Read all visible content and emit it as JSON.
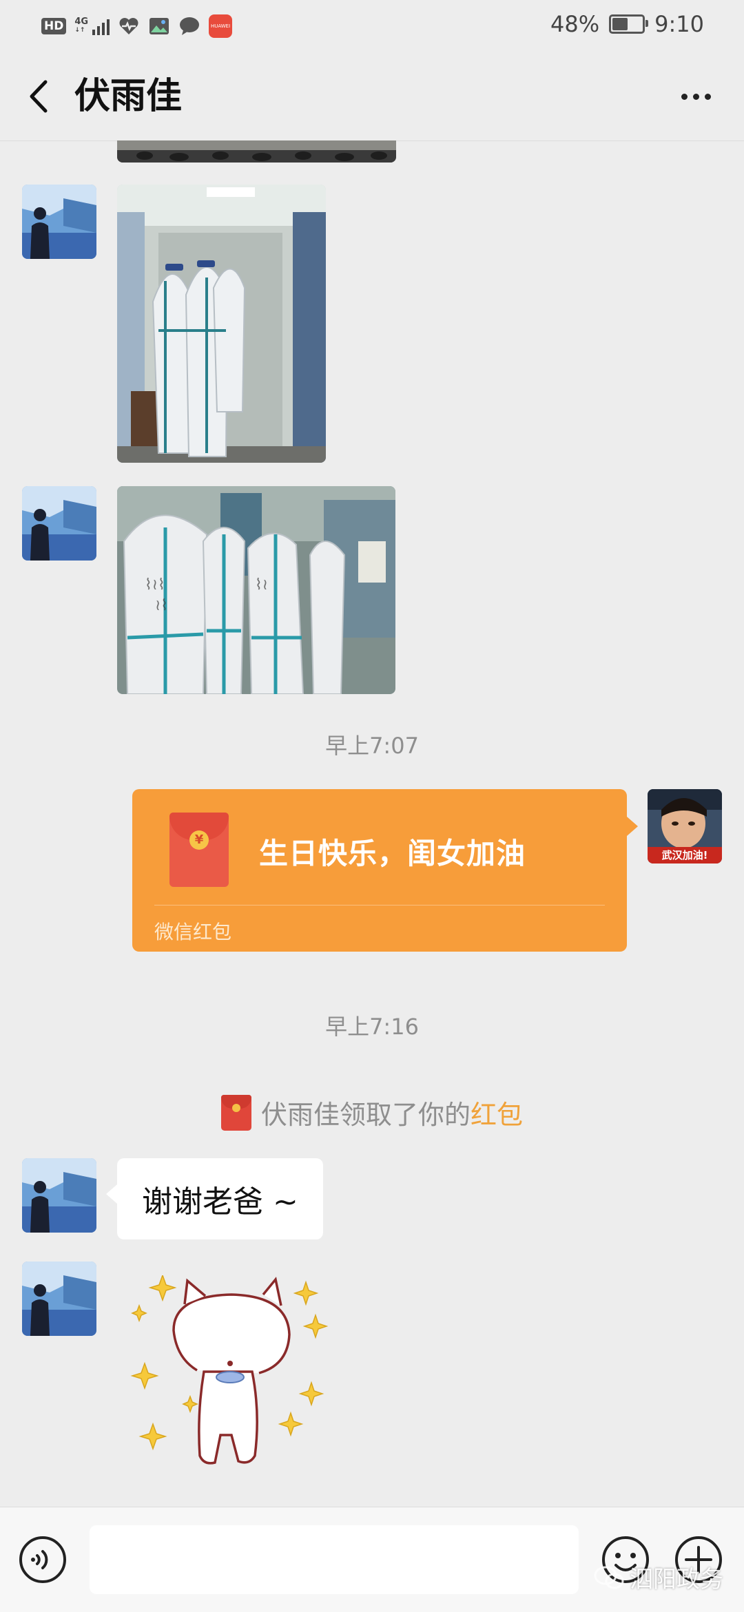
{
  "status_bar": {
    "hd": "HD",
    "network": "4G",
    "battery_percent": "48%",
    "battery_level": 0.48,
    "time": "9:10",
    "app_badge": "HUAWEI"
  },
  "header": {
    "title": "伏雨佳",
    "back_icon": "chevron-left-icon",
    "more_icon": "more-dots-icon"
  },
  "messages": {
    "time_1": "早上7:07",
    "red_packet": {
      "greeting": "生日快乐，闺女加油",
      "footer": "微信红包",
      "coin": "¥"
    },
    "sender_avatar_caption": "武汉加油!",
    "time_2": "早上7:16",
    "notice": {
      "text": "伏雨佳领取了你的",
      "link": "红包"
    },
    "reply": "谢谢老爸 ~"
  },
  "input_bar": {
    "placeholder": "",
    "voice_icon": "voice-icon",
    "emoji_icon": "emoji-icon",
    "plus_icon": "plus-icon"
  },
  "watermark": "泗阳政务",
  "colors": {
    "background": "#ededed",
    "red_packet": "#f79d3a",
    "link": "#f0a23a"
  }
}
